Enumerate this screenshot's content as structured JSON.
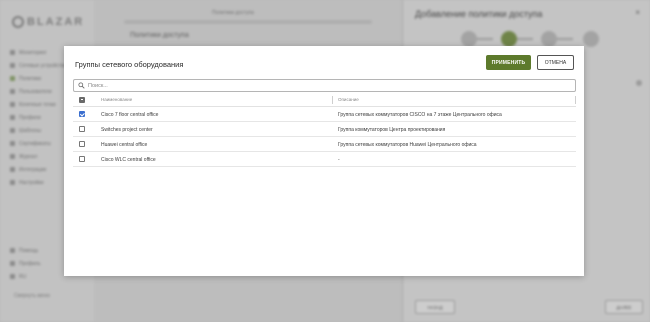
{
  "background": {
    "logo_text": "BLAZAR",
    "nav_items": [
      {
        "label": "Мониторинг",
        "active": false
      },
      {
        "label": "Сетевые устройства",
        "active": false
      },
      {
        "label": "Политики",
        "active": true
      },
      {
        "label": "Пользователи",
        "active": false
      },
      {
        "label": "Конечные точки",
        "active": false
      },
      {
        "label": "Профили",
        "active": false
      },
      {
        "label": "Шаблоны",
        "active": false
      },
      {
        "label": "Сертификаты",
        "active": false
      },
      {
        "label": "Журнал",
        "active": false
      },
      {
        "label": "Интеграции",
        "active": false
      },
      {
        "label": "Настройки",
        "active": false
      }
    ],
    "nav_bottom": [
      {
        "label": "Помощь"
      },
      {
        "label": "Профиль"
      },
      {
        "label": "RU"
      }
    ],
    "nav_footer": "Свернуть меню",
    "main_top": "Политики доступа",
    "main_title": "Политики доступа",
    "drawer_title": "Добавление политики доступа",
    "drawer_close": "×",
    "drawer_back": "НАЗАД",
    "drawer_next": "ДАЛЕЕ"
  },
  "modal": {
    "title": "Группы сетевого оборудования",
    "apply_label": "ПРИМЕНИТЬ",
    "cancel_label": "ОТМЕНА",
    "search_placeholder": "Поиск...",
    "columns": {
      "name": "Наименование",
      "description": "Описание"
    },
    "rows": [
      {
        "checked": true,
        "name": "Cisco 7 floor central office",
        "description": "Группа сетевых коммутаторов CISCO на 7 этаже Центрального офиса"
      },
      {
        "checked": false,
        "name": "Switches project center",
        "description": "Группа коммутаторов Центра проектирования"
      },
      {
        "checked": false,
        "name": "Huawei central office",
        "description": "Группа сетевых коммутаторов Huawei Центрального офиса"
      },
      {
        "checked": false,
        "name": "Cisco WLC central office",
        "description": "-"
      }
    ]
  },
  "colors": {
    "accent": "#5d7a2c",
    "checkbox_checked": "#3b6fcf",
    "overlay": "#b9b9b9"
  }
}
